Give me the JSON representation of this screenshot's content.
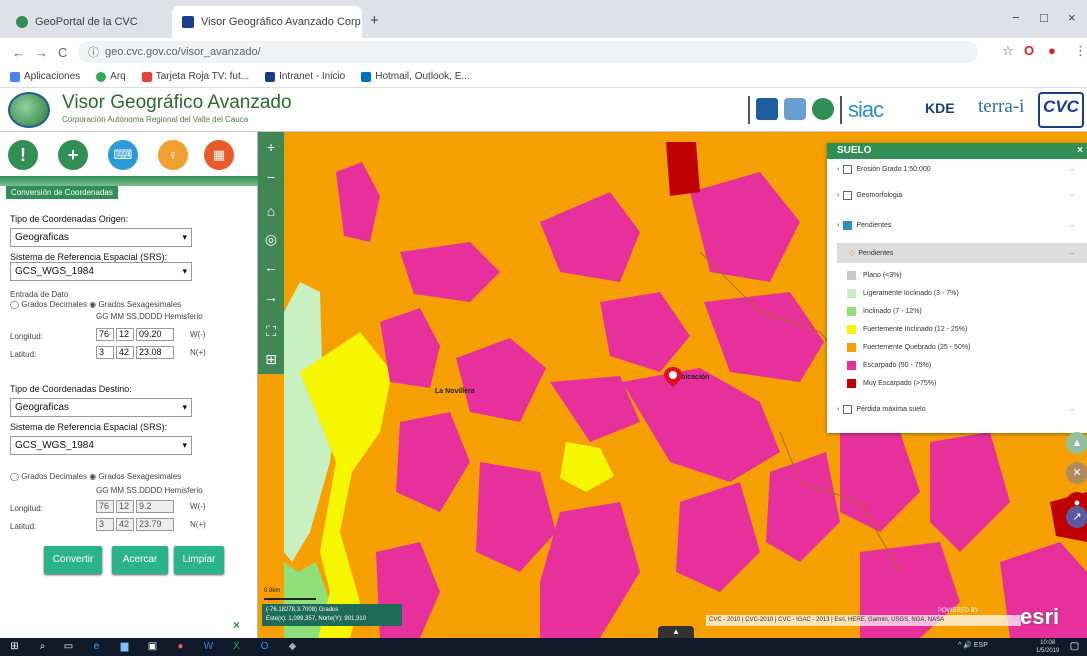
{
  "browser": {
    "tabs": [
      {
        "label": "GeoPortal de la CVC",
        "close": "×"
      },
      {
        "label": "Visor Geográfico Avanzado Corp",
        "close": "×"
      }
    ],
    "new_tab": "+",
    "url": "geo.cvc.gov.co/visor_avanzado/",
    "window_controls": {
      "minimize": "−",
      "maximize": "□",
      "close": "×"
    },
    "bookmarks": [
      {
        "label": "Aplicaciones",
        "color": "#4285f4"
      },
      {
        "label": "Arq",
        "color": "#34a853"
      },
      {
        "label": "Tarjeta Roja TV: fut...",
        "color": "#ea4335"
      },
      {
        "label": "Intranet - Inicio",
        "color": "#1a3d8a"
      },
      {
        "label": "Hotmail, Outlook, E...",
        "color": "#0072c6"
      }
    ]
  },
  "app": {
    "title": "Visor Geográfico Avanzado",
    "subtitle": "Corporación Autónoma Regional del Valle del Cauca",
    "logos": {
      "siac": "siac",
      "kde": "KDE",
      "terra": "terra-i",
      "cvc": "CVC"
    }
  },
  "panel": {
    "section_tab": "Conversión de Coordenadas",
    "origin": {
      "type_label": "Tipo de Coordenadas Origen:",
      "type_value": "Geograficas",
      "srs_label": "Sistema de Referencia Espacial (SRS):",
      "srs_value": "GCS_WGS_1984",
      "entry_label": "Entrada de Dato",
      "radio_decimal": "Grados Decimales",
      "radio_sexagesimal": "Grados Sexagesimales",
      "col_headers": "GG  MM  SS,DDDD  Hemisferio",
      "lon_label": "Longitud:",
      "lon": {
        "gg": "76",
        "mm": "12",
        "ss": "09.20",
        "hemi": "W(-)"
      },
      "lat_label": "Latitud:",
      "lat": {
        "gg": "3",
        "mm": "42",
        "ss": "23.08",
        "hemi": "N(+)"
      }
    },
    "destination": {
      "type_label": "Tipo de Coordenadas Destino:",
      "type_value": "Geograficas",
      "srs_label": "Sistema de Referencia Espacial (SRS):",
      "srs_value": "GCS_WGS_1984",
      "radio_decimal": "Grados Decimales",
      "radio_sexagesimal": "Grados Sexagesimales",
      "col_headers": "GG  MM  SS,DDDD  Hemisferio",
      "lon_label": "Longitud:",
      "lon": {
        "gg": "76",
        "mm": "12",
        "ss": "9.2",
        "hemi": "W(-)"
      },
      "lat_label": "Latitud:",
      "lat": {
        "gg": "3",
        "mm": "42",
        "ss": "23.79",
        "hemi": "N(+)"
      }
    },
    "buttons": {
      "convert": "Convertir",
      "zoom": "Acercar",
      "clear": "Limpiar"
    },
    "close": "×"
  },
  "legend": {
    "title": "SUELO",
    "close": "×",
    "layers": [
      {
        "label": "Erosión Grado 1:50.000",
        "checked": false
      },
      {
        "label": "Geomorfologia",
        "checked": false
      },
      {
        "label": "Pendientes",
        "checked": true
      }
    ],
    "group_header": "Pendientes",
    "classes": [
      {
        "label": "Plano (<3%)",
        "color": "#c8c8c8"
      },
      {
        "label": "Ligeramente Inclinado (3 - 7%)",
        "color": "#c8f0c0"
      },
      {
        "label": "Inclinado (7 - 12%)",
        "color": "#8fe07a"
      },
      {
        "label": "Fuertemente Inclinado (12 - 25%)",
        "color": "#f6f600"
      },
      {
        "label": "Fuertemente Quebrado (25 - 50%)",
        "color": "#f5a000"
      },
      {
        "label": "Escarpado (50 - 75%)",
        "color": "#e8309c"
      },
      {
        "label": "Muy Escarpado (>75%)",
        "color": "#c00000"
      }
    ],
    "last_layer": {
      "label": "Pérdida máxima suelo",
      "checked": false
    },
    "more": "..."
  },
  "map": {
    "place_label": "La Novillera",
    "marker_label": "Ubicación",
    "scale_label": "0 8km",
    "coords_line1": "(-76.18278,3.7008) Grados",
    "coords_line2": "Este(x): 1,099,357, Norte(Y): 901,310",
    "attribution": "CVC - 2010 | CVC-2010 | CVC - IGAC - 2013 | Esri, HERE, Garmin, USGS, NGA, NASA",
    "powered": "POWERED BY",
    "esri": "esri"
  },
  "taskbar": {
    "tray": "^ 🔊 ESP",
    "time": "10:08",
    "date": "1/5/2019"
  }
}
